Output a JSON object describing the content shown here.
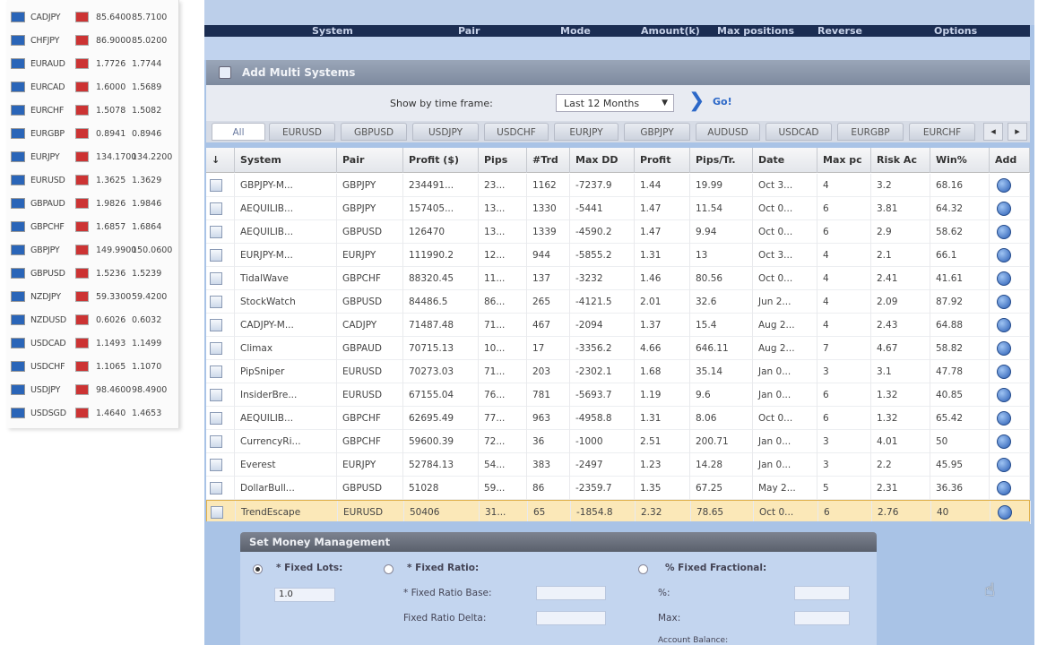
{
  "quotes": [
    {
      "symbol": "CADJPY",
      "bid": "85.6400",
      "ask": "85.7100"
    },
    {
      "symbol": "CHFJPY",
      "bid": "86.9000",
      "ask": "85.0200"
    },
    {
      "symbol": "EURAUD",
      "bid": "1.7726",
      "ask": "1.7744"
    },
    {
      "symbol": "EURCAD",
      "bid": "1.6000",
      "ask": "1.5689"
    },
    {
      "symbol": "EURCHF",
      "bid": "1.5078",
      "ask": "1.5082"
    },
    {
      "symbol": "EURGBP",
      "bid": "0.8941",
      "ask": "0.8946"
    },
    {
      "symbol": "EURJPY",
      "bid": "134.1700",
      "ask": "134.2200"
    },
    {
      "symbol": "EURUSD",
      "bid": "1.3625",
      "ask": "1.3629"
    },
    {
      "symbol": "GBPAUD",
      "bid": "1.9826",
      "ask": "1.9846"
    },
    {
      "symbol": "GBPCHF",
      "bid": "1.6857",
      "ask": "1.6864"
    },
    {
      "symbol": "GBPJPY",
      "bid": "149.9900",
      "ask": "150.0600"
    },
    {
      "symbol": "GBPUSD",
      "bid": "1.5236",
      "ask": "1.5239"
    },
    {
      "symbol": "NZDJPY",
      "bid": "59.3300",
      "ask": "59.4200"
    },
    {
      "symbol": "NZDUSD",
      "bid": "0.6026",
      "ask": "0.6032"
    },
    {
      "symbol": "USDCAD",
      "bid": "1.1493",
      "ask": "1.1499"
    },
    {
      "symbol": "USDCHF",
      "bid": "1.1065",
      "ask": "1.1070"
    },
    {
      "symbol": "USDJPY",
      "bid": "98.4600",
      "ask": "98.4900"
    },
    {
      "symbol": "USDSGD",
      "bid": "1.4640",
      "ask": "1.4653"
    }
  ],
  "header_bar": [
    "System",
    "Pair",
    "Mode",
    "Amount(k)",
    "Max positions",
    "Reverse",
    "Options"
  ],
  "add_multi": {
    "title": "Add Multi Systems"
  },
  "filter": {
    "label": "Show by time frame:",
    "value": "Last 12 Months",
    "go": "Go!"
  },
  "tabs": [
    "All",
    "EURUSD",
    "GBPUSD",
    "USDJPY",
    "USDCHF",
    "EURJPY",
    "GBPJPY",
    "AUDUSD",
    "USDCAD",
    "EURGBP",
    "EURCHF"
  ],
  "nav": {
    "prev": "◂",
    "next": "▸"
  },
  "columns": [
    "↓",
    "System",
    "Pair",
    "Profit ($)",
    "Pips",
    "#Trd",
    "Max DD",
    "Profit",
    "Pips/Tr.",
    "Date",
    "Max pc",
    "Risk Ac",
    "Win%",
    " Add"
  ],
  "rows": [
    [
      "GBPJPY-M...",
      "GBPJPY",
      "234491...",
      "23...",
      "1162",
      "-7237.9",
      "1.44",
      "19.99",
      "Oct 3...",
      "4",
      "3.2",
      "68.16"
    ],
    [
      "AEQUILIB...",
      "GBPJPY",
      "157405...",
      "13...",
      "1330",
      "-5441",
      "1.47",
      "11.54",
      "Oct 0...",
      "6",
      "3.81",
      "64.32"
    ],
    [
      "AEQUILIB...",
      "GBPUSD",
      "126470",
      "13...",
      "1339",
      "-4590.2",
      "1.47",
      "9.94",
      "Oct 0...",
      "6",
      "2.9",
      "58.62"
    ],
    [
      "EURJPY-M...",
      "EURJPY",
      "111990.2",
      "12...",
      "944",
      "-5855.2",
      "1.31",
      "13",
      "Oct 3...",
      "4",
      "2.1",
      "66.1"
    ],
    [
      "TidalWave",
      "GBPCHF",
      "88320.45",
      "11...",
      "137",
      "-3232",
      "1.46",
      "80.56",
      "Oct 0...",
      "4",
      "2.41",
      "41.61"
    ],
    [
      "StockWatch",
      "GBPUSD",
      "84486.5",
      "86...",
      "265",
      "-4121.5",
      "2.01",
      "32.6",
      "Jun 2...",
      "4",
      "2.09",
      "87.92"
    ],
    [
      "CADJPY-M...",
      "CADJPY",
      "71487.48",
      "71...",
      "467",
      "-2094",
      "1.37",
      "15.4",
      "Aug 2...",
      "4",
      "2.43",
      "64.88"
    ],
    [
      "Climax",
      "GBPAUD",
      "70715.13",
      "10...",
      "17",
      "-3356.2",
      "4.66",
      "646.11",
      "Aug 2...",
      "7",
      "4.67",
      "58.82"
    ],
    [
      "PipSniper",
      "EURUSD",
      "70273.03",
      "71...",
      "203",
      "-2302.1",
      "1.68",
      "35.14",
      "Jan 0...",
      "3",
      "3.1",
      "47.78"
    ],
    [
      "InsiderBre...",
      "EURUSD",
      "67155.04",
      "76...",
      "781",
      "-5693.7",
      "1.19",
      "9.6",
      "Jan 0...",
      "6",
      "1.32",
      "40.85"
    ],
    [
      "AEQUILIB...",
      "GBPCHF",
      "62695.49",
      "77...",
      "963",
      "-4958.8",
      "1.31",
      "8.06",
      "Oct 0...",
      "6",
      "1.32",
      "65.42"
    ],
    [
      "CurrencyRi...",
      "GBPCHF",
      "59600.39",
      "72...",
      "36",
      "-1000",
      "2.51",
      "200.71",
      "Jan 0...",
      "3",
      "4.01",
      "50"
    ],
    [
      "Everest",
      "EURJPY",
      "52784.13",
      "54...",
      "383",
      "-2497",
      "1.23",
      "14.28",
      "Jan 0...",
      "3",
      "2.2",
      "45.95"
    ],
    [
      "DollarBull...",
      "GBPUSD",
      "51028",
      "59...",
      "86",
      "-2359.7",
      "1.35",
      "67.25",
      "May 2...",
      "5",
      "2.31",
      "36.36"
    ],
    [
      "TrendEscape",
      "EURUSD",
      "50406",
      "31...",
      "65",
      "-1854.8",
      "2.32",
      "78.65",
      "Oct 0...",
      "6",
      "2.76",
      "40"
    ]
  ],
  "money_management": {
    "title": "Set Money Management",
    "fixed_lots": "* Fixed Lots:",
    "fixed_lots_value": "1.0",
    "fixed_ratio": "* Fixed Ratio:",
    "fixed_ratio_base": "* Fixed Ratio Base:",
    "fixed_ratio_delta": "Fixed Ratio Delta:",
    "fixed_fractional": "% Fixed Fractional:",
    "pct": "%:",
    "max": "Max:",
    "account_balance": "Account Balance:"
  }
}
